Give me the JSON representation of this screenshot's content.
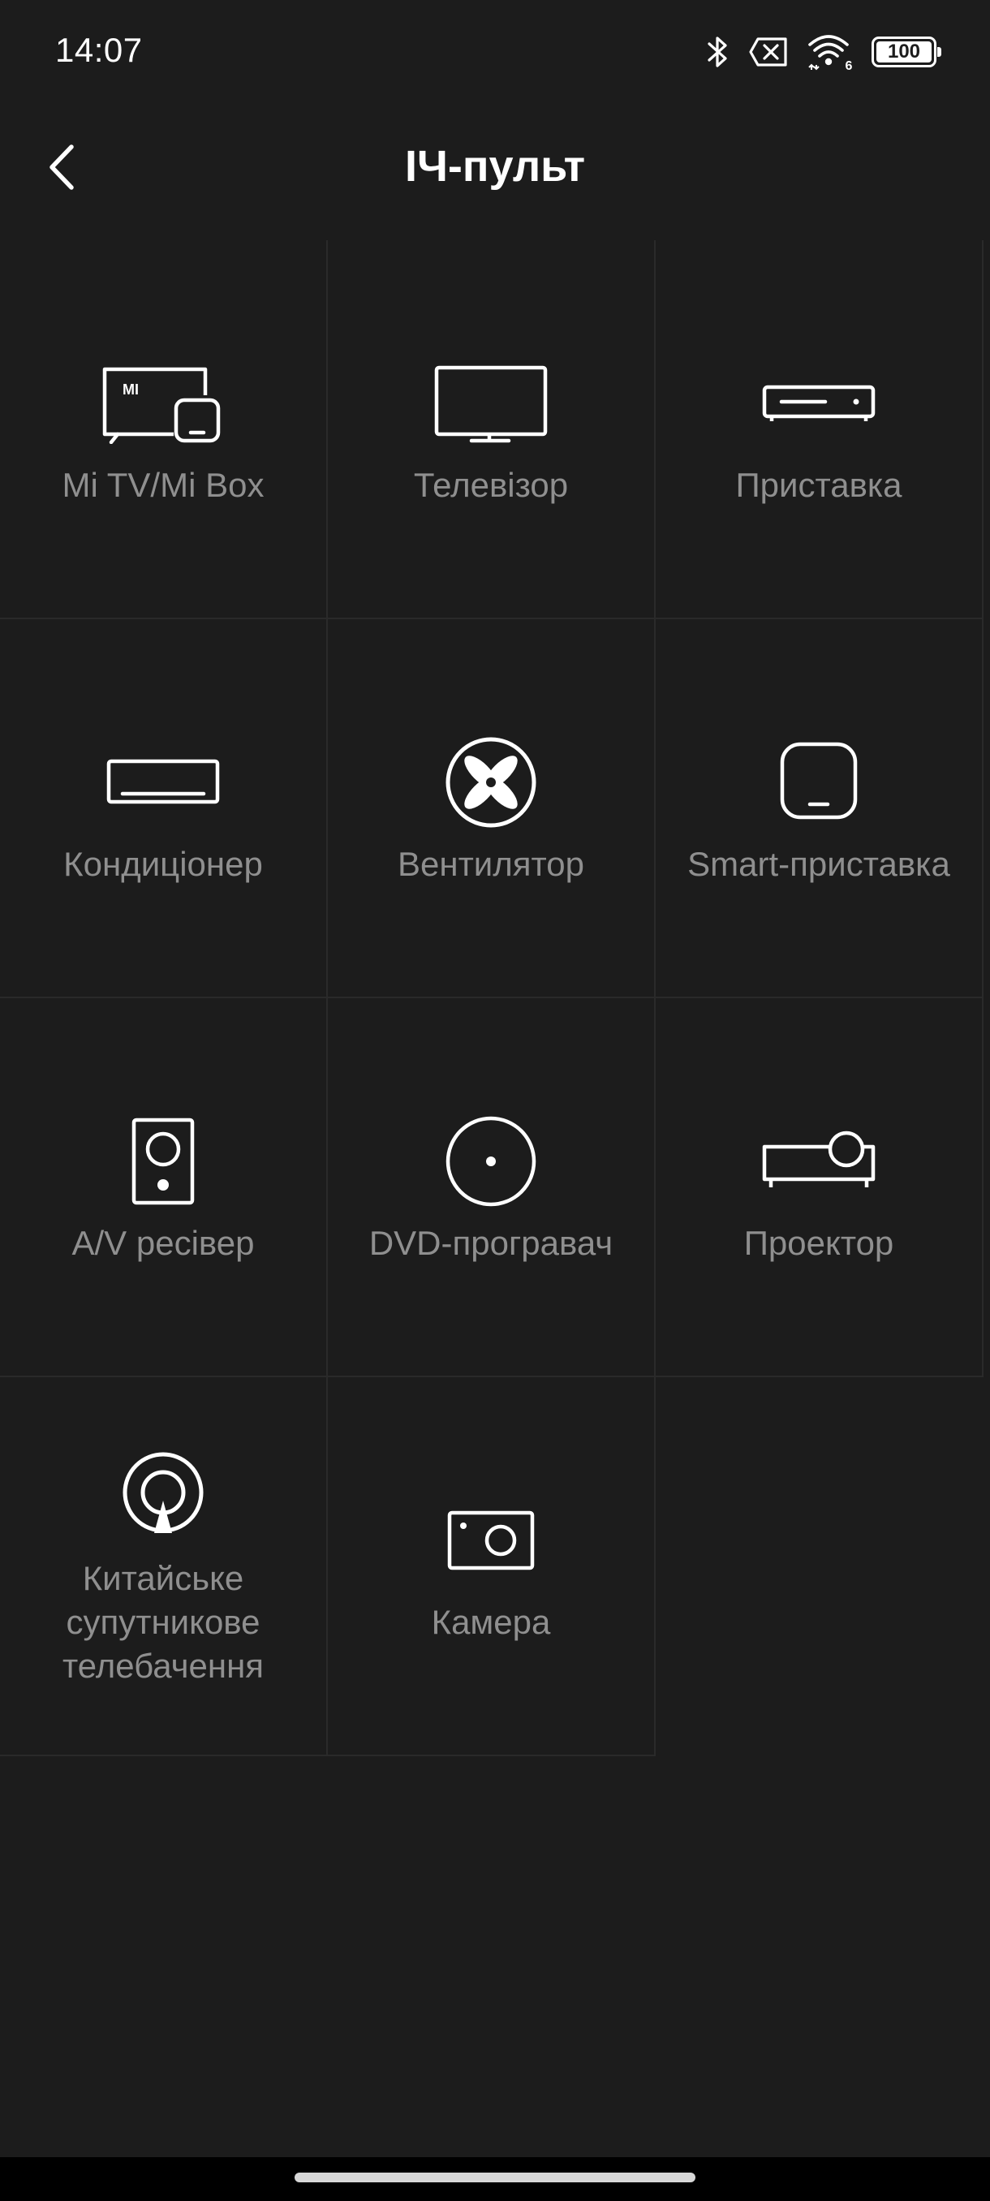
{
  "status_bar": {
    "time": "14:07",
    "battery": "100",
    "wifi_badge": "6"
  },
  "header": {
    "title": "ІЧ-пульт"
  },
  "devices": [
    {
      "label": "Mi TV/Mi Box",
      "icon": "mi-tv-box-icon"
    },
    {
      "label": "Телевізор",
      "icon": "tv-icon"
    },
    {
      "label": "Приставка",
      "icon": "set-top-box-icon"
    },
    {
      "label": "Кондиціонер",
      "icon": "air-conditioner-icon"
    },
    {
      "label": "Вентилятор",
      "icon": "fan-icon"
    },
    {
      "label": "Smart-приставка",
      "icon": "smart-box-icon"
    },
    {
      "label": "A/V ресівер",
      "icon": "speaker-icon"
    },
    {
      "label": "DVD-програвач",
      "icon": "dvd-icon"
    },
    {
      "label": "Проектор",
      "icon": "projector-icon"
    },
    {
      "label": "Китайське\nсупутникове\nтелебачення",
      "icon": "satellite-icon"
    },
    {
      "label": "Камера",
      "icon": "camera-icon"
    }
  ],
  "colors": {
    "background": "#1c1c1c",
    "label": "#8f8f8f",
    "divider": "#2a2a2a",
    "icon": "#ffffff"
  }
}
